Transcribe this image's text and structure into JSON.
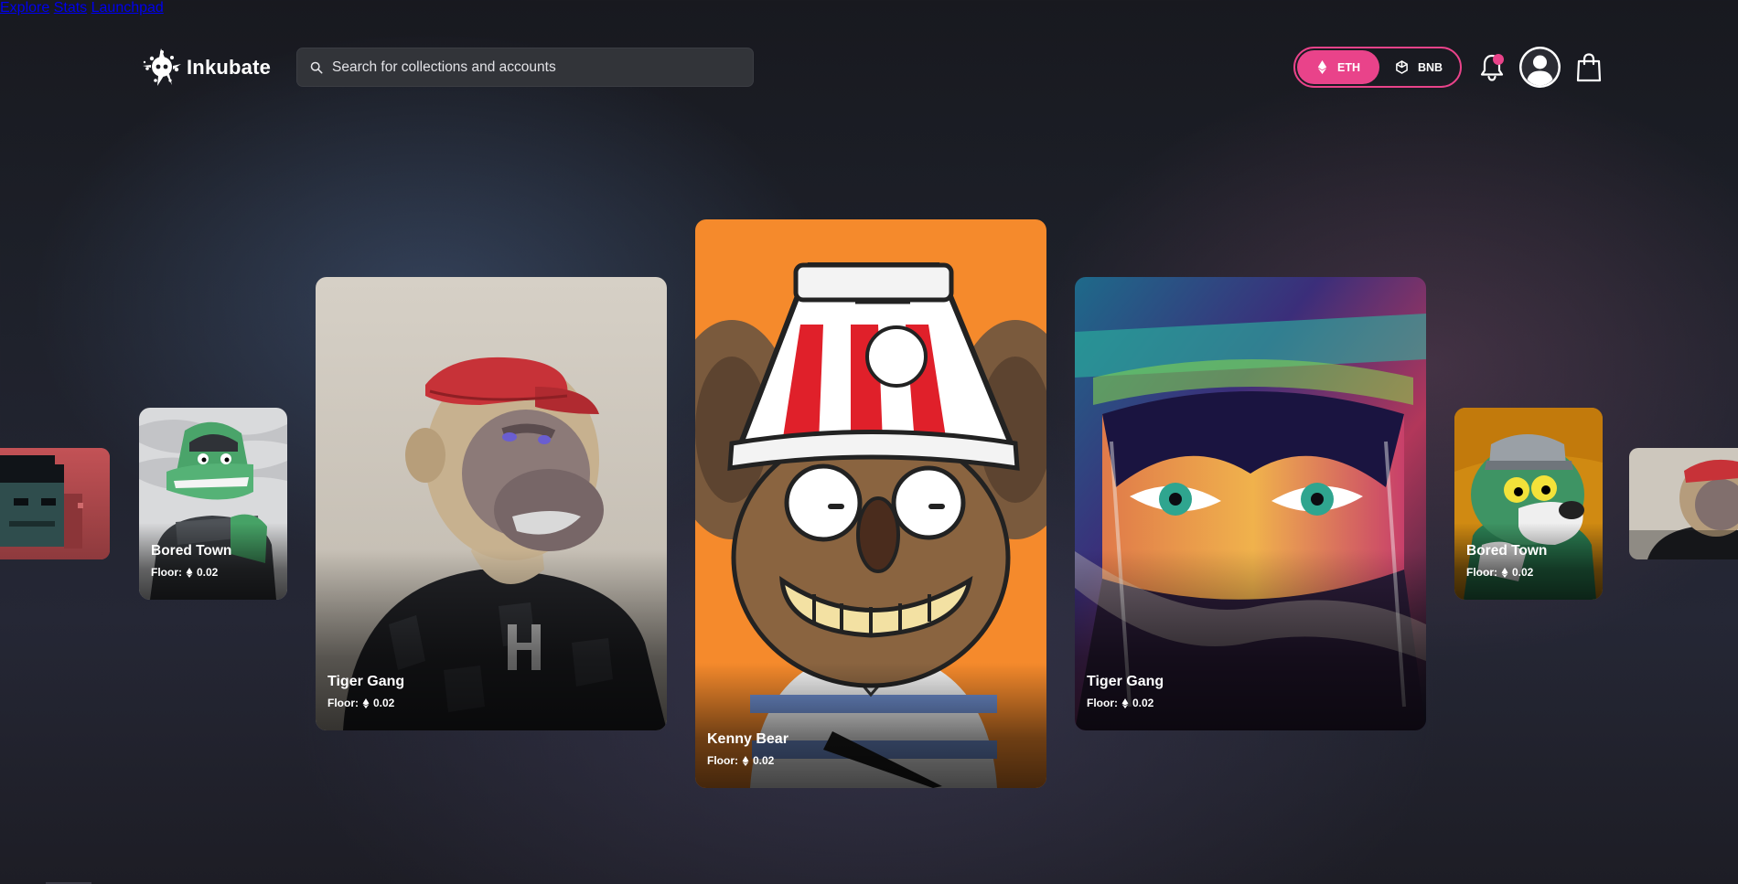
{
  "brand": {
    "name": "Inkubate"
  },
  "search": {
    "placeholder": "Search for collections and accounts"
  },
  "nav": {
    "explore": "Explore",
    "stats": "Stats",
    "launchpad": "Launchpad"
  },
  "chain_toggle": {
    "eth": "ETH",
    "bnb": "BNB",
    "selected": "ETH"
  },
  "icons": {
    "search": "search-icon",
    "eth": "eth-icon",
    "bnb": "bnb-icon",
    "bell": "bell-icon",
    "avatar": "user-avatar-icon",
    "bag": "shopping-bag-icon"
  },
  "colors": {
    "accent": "#e9438a",
    "search_bg": "#323439"
  },
  "floor_label": "Floor:",
  "cards": [
    {
      "name": "",
      "floor": ""
    },
    {
      "name": "Bored Town",
      "floor": "0.02"
    },
    {
      "name": "Tiger Gang",
      "floor": "0.02"
    },
    {
      "name": "Kenny Bear",
      "floor": "0.02"
    },
    {
      "name": "Tiger Gang",
      "floor": "0.02"
    },
    {
      "name": "Bored Town",
      "floor": "0.02"
    },
    {
      "name": "",
      "floor": ""
    }
  ]
}
